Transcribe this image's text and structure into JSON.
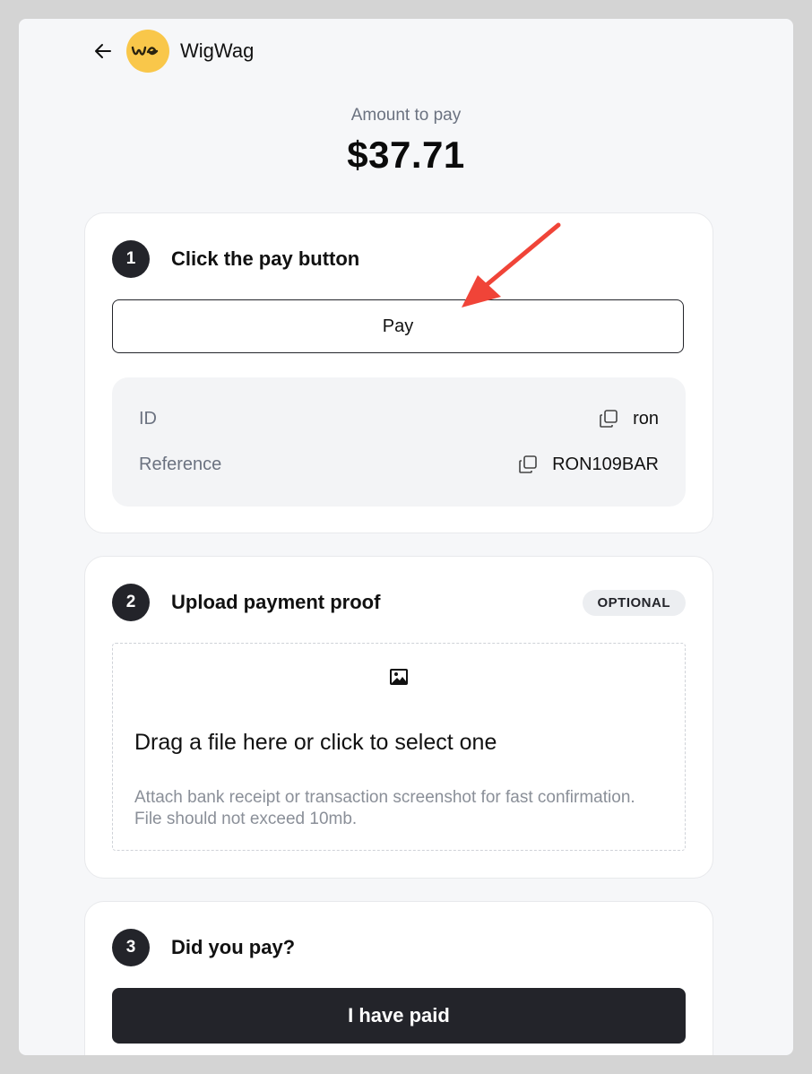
{
  "header": {
    "brand": "WigWag",
    "logo_text": "we"
  },
  "payment": {
    "amount_label": "Amount to pay",
    "amount": "$37.71"
  },
  "step1": {
    "number": "1",
    "title": "Click the pay button",
    "pay_label": "Pay",
    "rows": [
      {
        "label": "ID",
        "value": "ron"
      },
      {
        "label": "Reference",
        "value": "RON109BAR"
      }
    ]
  },
  "step2": {
    "number": "2",
    "title": "Upload payment proof",
    "badge": "OPTIONAL",
    "drop_title": "Drag a file here or click to select one",
    "drop_help": "Attach bank receipt or transaction screenshot for fast confirmation. File should not exceed 10mb."
  },
  "step3": {
    "number": "3",
    "title": "Did you pay?",
    "paid_label": "I have paid"
  },
  "colors": {
    "accent_dark": "#23242a",
    "logo_yellow": "#f9c74a",
    "annotation_red": "#f04438"
  },
  "icons": [
    "back-arrow-icon",
    "copy-icon",
    "image-icon"
  ]
}
